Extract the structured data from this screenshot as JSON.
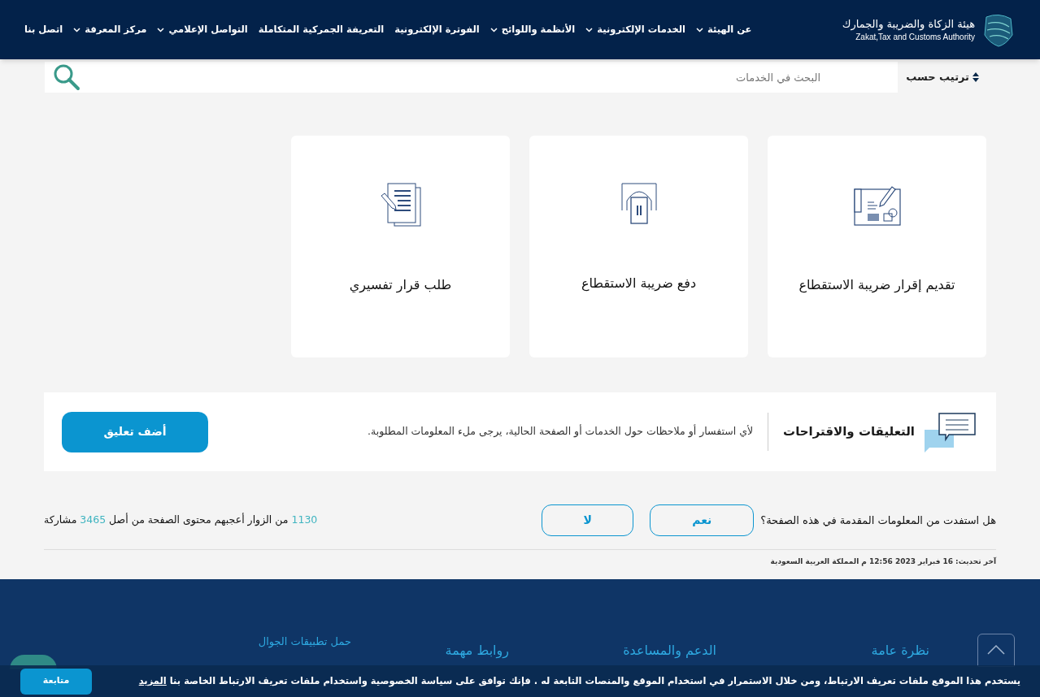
{
  "header": {
    "logo_title": "هيئة الزكاة والضريبة والجمارك",
    "logo_subtitle": "Zakat,Tax and Customs Authority",
    "nav": [
      {
        "label": "عن الهيئة",
        "dropdown": true
      },
      {
        "label": "الخدمات الإلكترونية",
        "dropdown": true
      },
      {
        "label": "الأنظمة واللوائح",
        "dropdown": true
      },
      {
        "label": "الفوترة الإلكترونية",
        "dropdown": false
      },
      {
        "label": "التعريفة الجمركية المتكاملة",
        "dropdown": false
      },
      {
        "label": "التواصل الإعلامي",
        "dropdown": true
      },
      {
        "label": "مركز المعرفة",
        "dropdown": true
      },
      {
        "label": "اتصل بنا",
        "dropdown": false
      }
    ]
  },
  "toolbar": {
    "sort_label": "ترتيب حسب",
    "search": {
      "placeholder": "البحث في الخدمات"
    }
  },
  "services": [
    {
      "kind": "declaration",
      "title": "تقديم إقرار ضريبة الاستقطاع"
    },
    {
      "kind": "payment",
      "title": "دفع ضريبة الاستقطاع"
    },
    {
      "kind": "document",
      "title": "طلب قرار تفسيري"
    }
  ],
  "feedback": {
    "title": "التعليقات والاقتراحات",
    "text": "لأي استفسار أو ملاحظات حول الخدمات أو الصفحة الحالية، يرجى ملء المعلومات المطلوبة.",
    "button": "أضف تعليق"
  },
  "rating": {
    "question": "هل استفدت من المعلومات المقدمة في هذه الصفحة؟",
    "yes": "نعم",
    "no": "لا",
    "liked": "1130",
    "liked_text": "من الزوار أعجبهم محتوى الصفحة من أصل",
    "total": "3465",
    "total_text": "مشاركة"
  },
  "last_update": "آخر تحديث: 16 فبراير 2023 12:56 م المملكة العربية السعودية",
  "footer": {
    "columns": [
      "نظرة عامة",
      "الدعم والمساعدة",
      "روابط مهمة"
    ],
    "apps_title": "حمل تطبيقات الجوال"
  },
  "cookie": {
    "text": "يستخدم هذا الموقع ملفات تعريف الارتباط، ومن خلال الاستمرار في استخدام الموقع والمنصات التابعة له . فإنك توافق على سياسة الخصوصية واستخدام ملفات تعريف الارتباط الخاصة بنا",
    "link": "المزيد",
    "button": "متابعة"
  }
}
